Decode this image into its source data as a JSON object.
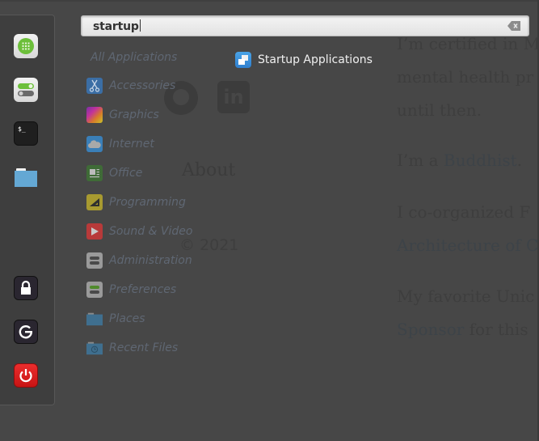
{
  "background_page": {
    "social_links": [
      "github",
      "linkedin"
    ],
    "about_heading": "About",
    "copyright": "© 2021",
    "paragraph_lines": [
      {
        "text": "I’m certified in M",
        "link": ""
      },
      {
        "text": "mental health pr",
        "link": ""
      },
      {
        "text": "until then.",
        "link": ""
      },
      {
        "text": "I’m a ",
        "link": "Buddhist",
        "suffix": "."
      },
      {
        "text": "I co-organized F",
        "link": ""
      },
      {
        "text": "",
        "link": "Architecture of C"
      },
      {
        "text": "My favorite Unic",
        "link": ""
      },
      {
        "text": "",
        "link": "Sponsor",
        "suffix": " for this"
      }
    ]
  },
  "favorites": [
    {
      "name": "software-manager",
      "icon": "grid-icon"
    },
    {
      "name": "system-settings",
      "icon": "toggle-settings-icon"
    },
    {
      "name": "terminal",
      "icon": "terminal-icon"
    },
    {
      "name": "files",
      "icon": "folder-icon"
    },
    {
      "name": "lock-screen",
      "icon": "lock-icon"
    },
    {
      "name": "logout",
      "icon": "logout-icon"
    },
    {
      "name": "shutdown",
      "icon": "power-icon"
    }
  ],
  "search": {
    "value": "startup",
    "clear_icon": "backspace-clear-icon"
  },
  "categories": {
    "all_label": "All Applications",
    "items": [
      {
        "label": "Accessories",
        "icon": "scissors-icon",
        "color": "#3b6ea5"
      },
      {
        "label": "Graphics",
        "icon": "palette-icon",
        "color": "#8a3fa0"
      },
      {
        "label": "Internet",
        "icon": "cloud-icon",
        "color": "#3a7fb8"
      },
      {
        "label": "Office",
        "icon": "document-icon",
        "color": "#3f6b37"
      },
      {
        "label": "Programming",
        "icon": "ruler-icon",
        "color": "#a89a30"
      },
      {
        "label": "Sound & Video",
        "icon": "play-icon",
        "color": "#b83a3a"
      },
      {
        "label": "Administration",
        "icon": "toggles-icon",
        "color": "#8c8c8c"
      },
      {
        "label": "Preferences",
        "icon": "preferences-toggle-icon",
        "color": "#8c8c8c"
      },
      {
        "label": "Places",
        "icon": "folder-icon",
        "color": "#3f6f8f"
      },
      {
        "label": "Recent Files",
        "icon": "recent-folder-icon",
        "color": "#3f6f8f"
      }
    ]
  },
  "results": [
    {
      "label": "Startup Applications",
      "icon": "startup-applications-icon"
    }
  ]
}
